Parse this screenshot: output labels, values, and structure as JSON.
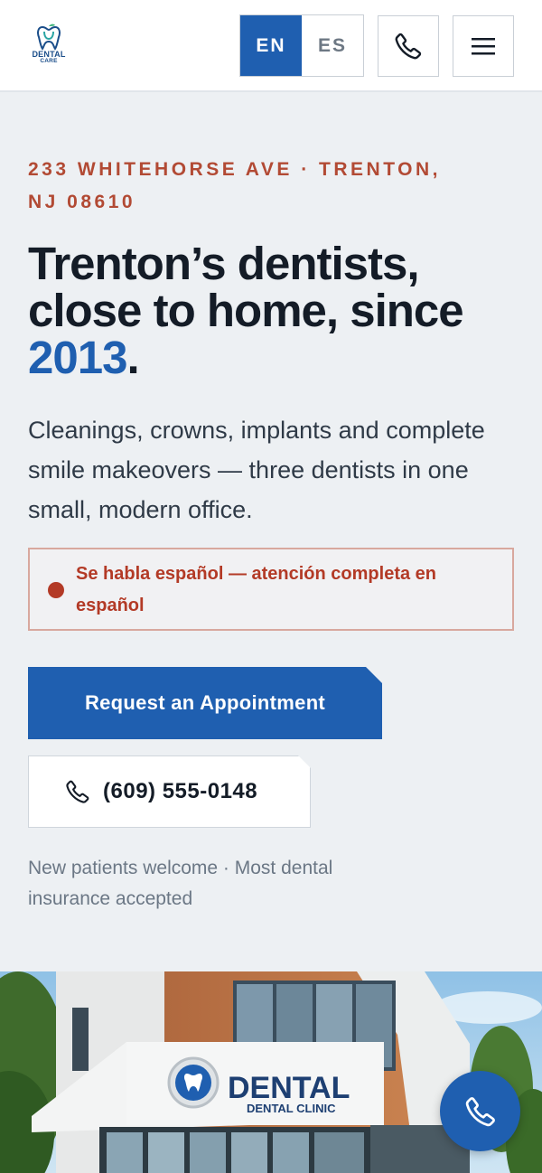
{
  "header": {
    "logo": {
      "line1": "DENTAL",
      "line2": "CARE"
    },
    "languages": {
      "active": "EN",
      "inactive": "ES"
    },
    "phone_icon": "phone-icon",
    "menu_icon": "hamburger-menu-icon"
  },
  "hero": {
    "address": "233 WHITEHORSE AVE · TRENTON, NJ 08610",
    "headline_pre": "Trenton’s dentists, close to home, since ",
    "headline_accent": "2013",
    "headline_post": ".",
    "lede": "Cleanings, crowns, implants and complete smile makeovers — three dentists in one small, modern office.",
    "spanish_notice": "Se habla español — atención completa en español",
    "cta_label": "Request an Appointment",
    "phone_number": "(609) 555-0148",
    "note": "New patients welcome · Most dental insurance accepted"
  },
  "image": {
    "sign_main": "DENTAL",
    "sign_sub": "DENTAL CLINIC"
  },
  "colors": {
    "brand_blue": "#1f5fb0",
    "accent_red": "#b24a34",
    "background": "#edf0f3"
  }
}
